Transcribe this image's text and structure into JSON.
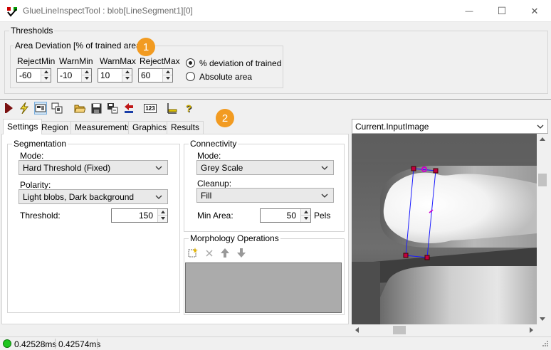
{
  "window": {
    "title": "GlueLineInspectTool : blob[LineSegment1][0]",
    "minimize_glyph": "—",
    "maximize_glyph": "☐",
    "close_glyph": "✕"
  },
  "thresholds": {
    "group_title": "Thresholds",
    "area_deviation": {
      "group_title": "Area Deviation [% of trained area]",
      "fields": [
        {
          "label": "RejectMin",
          "value": "-60"
        },
        {
          "label": "WarnMin",
          "value": "-10"
        },
        {
          "label": "WarnMax",
          "value": "10"
        },
        {
          "label": "RejectMax",
          "value": "60"
        }
      ],
      "options": [
        {
          "label": "% deviation of trained",
          "selected": true
        },
        {
          "label": "Absolute area",
          "selected": false
        }
      ]
    }
  },
  "badges": [
    "1",
    "2"
  ],
  "toolbar": {
    "icons": [
      "run-icon",
      "electric-run-icon",
      "show-display-icon",
      "copy-image-icon",
      "open-folder-icon",
      "save-icon",
      "save-as-icon",
      "reset-icon",
      "counter-icon",
      "ruler-icon",
      "help-icon"
    ],
    "help_glyph": "?",
    "counter_glyph": "123"
  },
  "tabs": [
    {
      "label": "Settings",
      "active": true
    },
    {
      "label": "Region",
      "active": false
    },
    {
      "label": "Measurements",
      "active": false
    },
    {
      "label": "Graphics",
      "active": false
    },
    {
      "label": "Results",
      "active": false
    }
  ],
  "segmentation": {
    "group_title": "Segmentation",
    "mode_label": "Mode:",
    "mode_value": "Hard Threshold (Fixed)",
    "polarity_label": "Polarity:",
    "polarity_value": "Light blobs, Dark background",
    "threshold_label": "Threshold:",
    "threshold_value": "150"
  },
  "connectivity": {
    "group_title": "Connectivity",
    "mode_label": "Mode:",
    "mode_value": "Grey Scale",
    "cleanup_label": "Cleanup:",
    "cleanup_value": "Fill",
    "min_area_label": "Min Area:",
    "min_area_value": "50",
    "min_area_unit": "Pels"
  },
  "morphology": {
    "group_title": "Morphology Operations",
    "tools": [
      "add-operation-icon",
      "delete-icon",
      "move-up-icon",
      "move-down-icon"
    ]
  },
  "image_panel": {
    "selector_value": "Current.InputImage"
  },
  "status": {
    "indicator_color": "#1ec51e",
    "time1": "0.42528ms",
    "time2": "0.42574ms"
  },
  "colors": {
    "badge": "#f29b21",
    "roi_line": "#1a1aff",
    "roi_handle": "#c00040"
  }
}
